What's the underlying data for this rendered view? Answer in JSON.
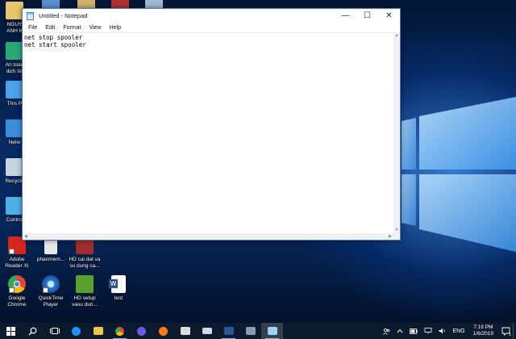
{
  "notepad": {
    "title": "Untitled - Notepad",
    "menu": [
      "File",
      "Edit",
      "Format",
      "View",
      "Help"
    ],
    "lines": [
      "net stop spooler",
      "net start spooler"
    ],
    "controls": {
      "minimize": "—",
      "maximize": "☐",
      "close": "✕"
    }
  },
  "desktop_icons": [
    {
      "label": "NGUY\nANH K",
      "icon": "user-folder-icon",
      "color": "#e9c46a"
    },
    {
      "label": "An toàn\ndịch tài",
      "icon": "security-app-icon",
      "color": "#2aa876"
    },
    {
      "label": "This P",
      "icon": "this-pc-icon",
      "color": "#4aa3e8"
    },
    {
      "label": "Netw",
      "icon": "network-icon",
      "color": "#3b8fd6"
    },
    {
      "label": "Recycle",
      "icon": "recycle-bin-icon",
      "color": "#c7d3e0"
    },
    {
      "label": "Control",
      "icon": "control-panel-icon",
      "color": "#4fb0e6"
    },
    {
      "label": "Adobe\nReader XI",
      "icon": "adobe-reader-icon",
      "color": "#d7261e"
    },
    {
      "label": "phanmem...",
      "icon": "file-icon",
      "color": "#e8e8e8"
    },
    {
      "label": "HD cai dat va\nsu dung ca...",
      "icon": "video-file-icon",
      "color": "#a12c2c"
    },
    {
      "label": "Google\nChrome",
      "icon": "chrome-icon",
      "color": "#e94235"
    },
    {
      "label": "QuickTime\nPlayer",
      "icon": "quicktime-icon",
      "color": "#2b7bd6"
    },
    {
      "label": "HD setup\nvasu dun...",
      "icon": "video-file-icon",
      "color": "#5aa02c"
    },
    {
      "label": "test",
      "icon": "word-doc-icon",
      "color": "#2b579a"
    }
  ],
  "taskbar": {
    "items": [
      {
        "name": "start-button",
        "icon": "windows-icon",
        "color": "#ffffff"
      },
      {
        "name": "search-button",
        "icon": "search-icon",
        "color": "#ffffff"
      },
      {
        "name": "task-view-button",
        "icon": "task-view-icon",
        "color": "#ffffff"
      },
      {
        "name": "taskbar-edge",
        "icon": "edge-icon",
        "color": "#1e90ff"
      },
      {
        "name": "taskbar-explorer",
        "icon": "folder-icon",
        "color": "#f3c44b"
      },
      {
        "name": "taskbar-chrome",
        "icon": "chrome-icon",
        "color": "#e94235"
      },
      {
        "name": "taskbar-firefox-dev",
        "icon": "firefox-dev-icon",
        "color": "#6a5adf"
      },
      {
        "name": "taskbar-firefox",
        "icon": "firefox-icon",
        "color": "#ff7a18"
      },
      {
        "name": "taskbar-store",
        "icon": "store-icon",
        "color": "#dcdcdc"
      },
      {
        "name": "taskbar-mail",
        "icon": "mail-icon",
        "color": "#cfd8e3"
      },
      {
        "name": "taskbar-word",
        "icon": "word-icon",
        "color": "#2b579a"
      },
      {
        "name": "taskbar-app",
        "icon": "app-icon",
        "color": "#8a9bb0"
      },
      {
        "name": "taskbar-notepad",
        "icon": "notepad-icon",
        "color": "#9fd0f5"
      }
    ],
    "tray": {
      "language": "ENG",
      "time": "7:19 PM",
      "date": "1/6/2019",
      "notifications": "1"
    }
  }
}
